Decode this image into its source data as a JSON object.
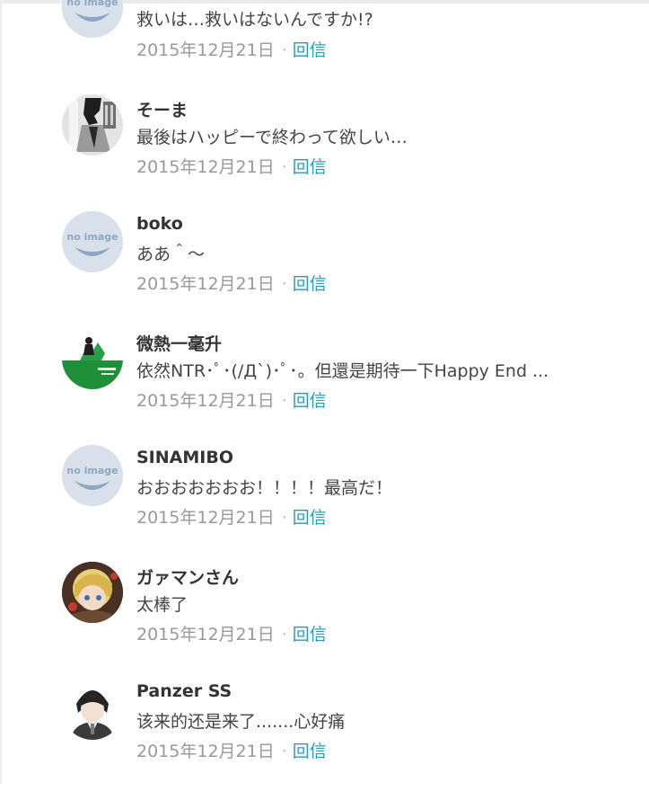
{
  "comments": [
    {
      "author": "",
      "text": "救いは…救いはないんですか!?",
      "date": "2015年12月21日",
      "reply": "回信",
      "avatar": "no-image-avatar"
    },
    {
      "author": "そーま",
      "text": "最後はハッピーで終わって欲しい…",
      "date": "2015年12月21日",
      "reply": "回信",
      "avatar": "manga-avatar"
    },
    {
      "author": "boko",
      "text": "ああ＾～",
      "date": "2015年12月21日",
      "reply": "回信",
      "avatar": "no-image-avatar"
    },
    {
      "author": "微熱一毫升",
      "text": "依然NTR･ﾟ･(/Д`)･ﾟ･。但還是期待一下Happy End ...",
      "date": "2015年12月21日",
      "reply": "回信",
      "avatar": "green-logo-avatar"
    },
    {
      "author": "SINAMIBO",
      "text": "おおおおおおお！！！！最高だ！",
      "date": "2015年12月21日",
      "reply": "回信",
      "avatar": "no-image-avatar"
    },
    {
      "author": "ガァマンさん",
      "text": "太棒了",
      "date": "2015年12月21日",
      "reply": "回信",
      "avatar": "anime-girl-avatar"
    },
    {
      "author": "Panzer SS",
      "text": "该来的还是来了.......心好痛",
      "date": "2015年12月21日",
      "reply": "回信",
      "avatar": "anime-boy-avatar"
    }
  ],
  "meta_separator": "·",
  "no_image_text": "no image",
  "colors": {
    "reply_link": "#2e99b4",
    "date": "#999999",
    "author": "#333333",
    "text": "#444444"
  }
}
